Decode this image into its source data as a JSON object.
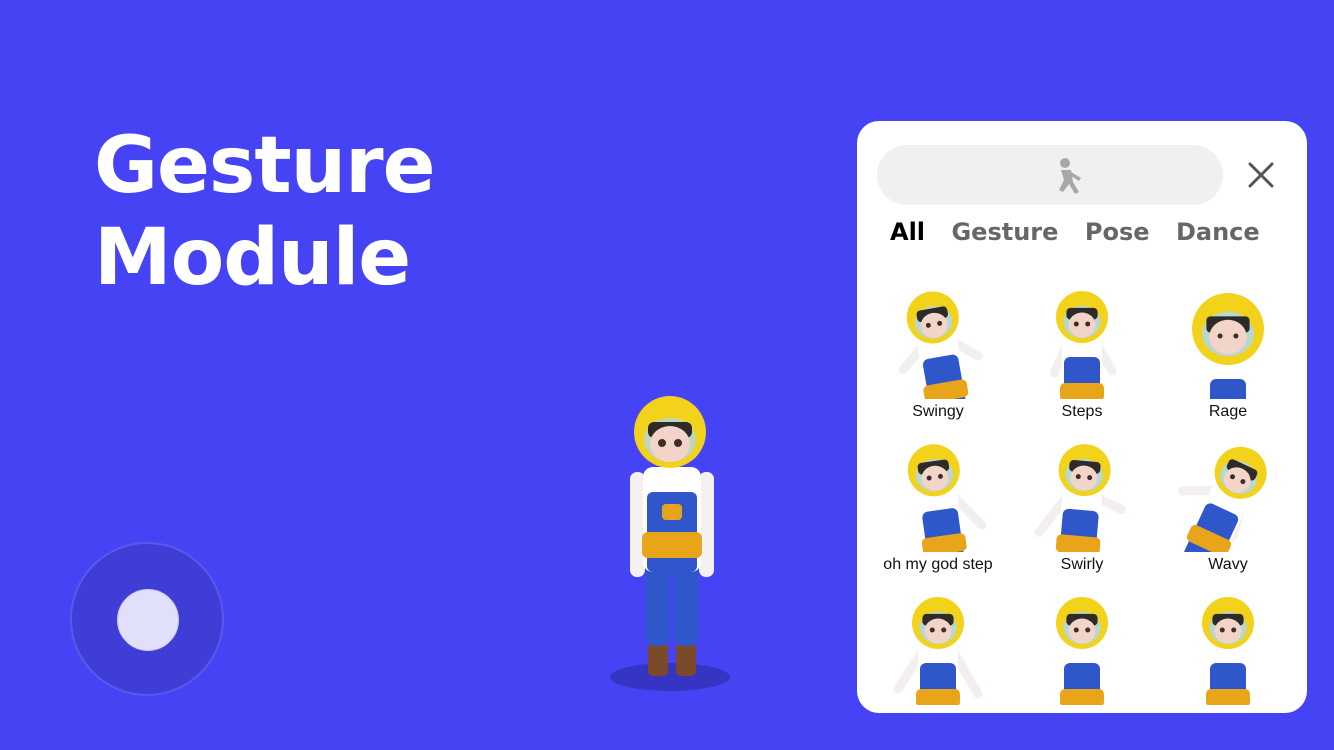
{
  "heading": {
    "line1": "Gesture",
    "line2": "Module"
  },
  "joystick": {
    "icon": "joystick"
  },
  "panel": {
    "search_icon": "dance-figure-icon",
    "close_icon": "close-x-icon",
    "tabs": [
      {
        "label": "All",
        "active": true
      },
      {
        "label": "Gesture",
        "active": false
      },
      {
        "label": "Pose",
        "active": false
      },
      {
        "label": "Dance",
        "active": false
      }
    ],
    "gestures": [
      {
        "label": "Swingy"
      },
      {
        "label": "Steps"
      },
      {
        "label": "Rage"
      },
      {
        "label": "oh my god step"
      },
      {
        "label": "Swirly"
      },
      {
        "label": "Wavy"
      },
      {
        "label": ""
      },
      {
        "label": ""
      },
      {
        "label": ""
      }
    ]
  },
  "colors": {
    "background": "#4543F4",
    "helmet": "#F2D21B",
    "overalls": "#2F57C9",
    "panel": "#FFFFFF"
  }
}
